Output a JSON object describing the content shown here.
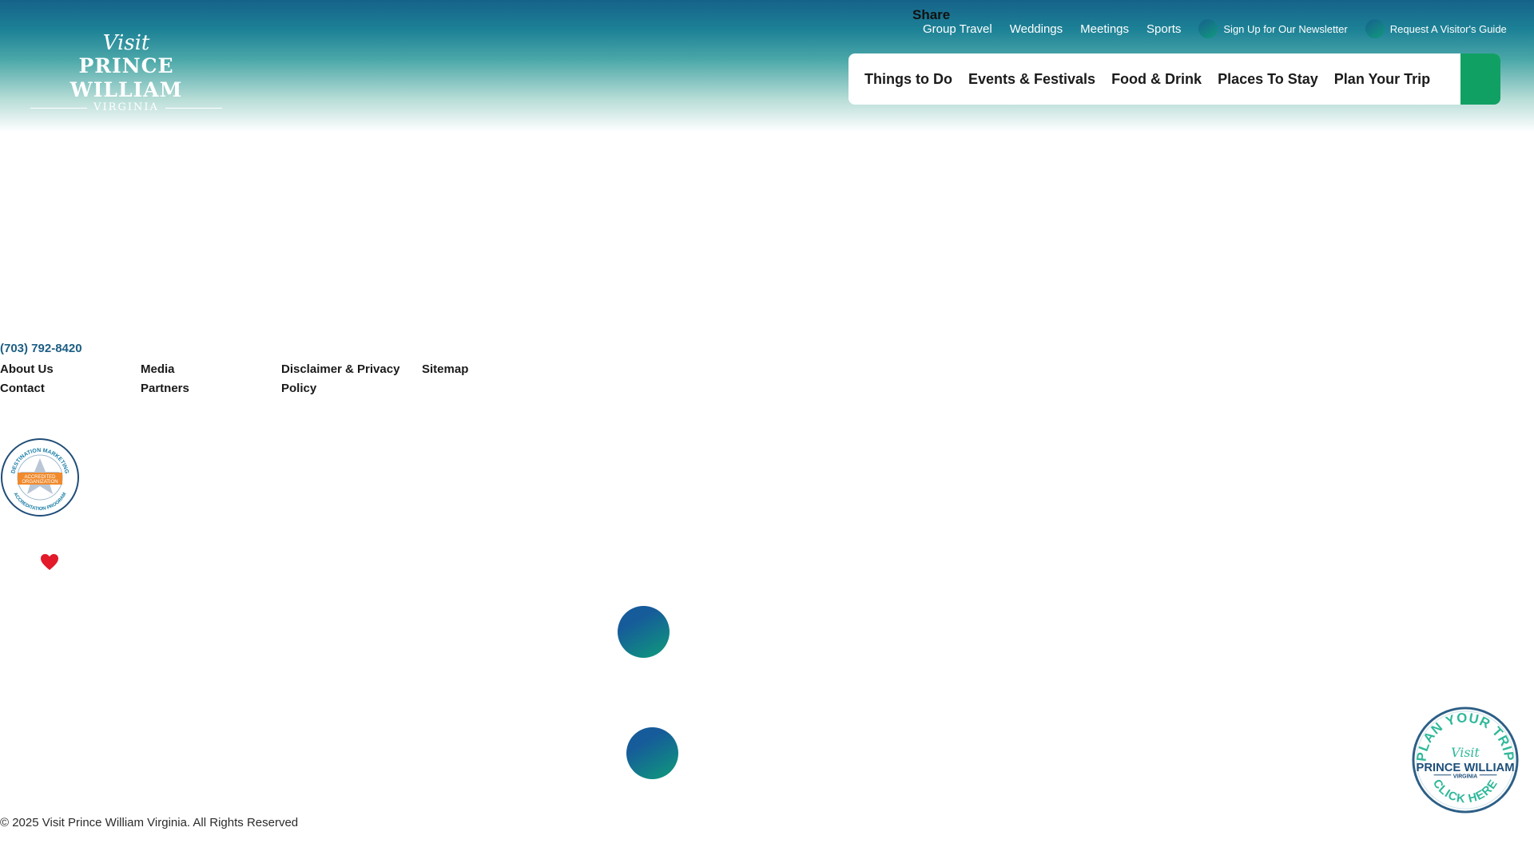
{
  "share": {
    "label": "Share"
  },
  "utility": {
    "links": [
      "Group Travel",
      "Weddings",
      "Meetings",
      "Sports"
    ],
    "newsletter": "Sign Up for  Our Newsletter",
    "guide": "Request A Visitor's Guide"
  },
  "logo": {
    "visit": "Visit",
    "name": "PRINCE WILLIAM",
    "sub": "VIRGINIA"
  },
  "nav": {
    "items": [
      "Things to Do",
      "Events & Festivals",
      "Food & Drink",
      "Places To Stay",
      "Plan Your Trip"
    ],
    "search_icon": "search-icon"
  },
  "footer": {
    "phone": "(703) 792-8420",
    "col1": [
      "About Us",
      "Contact"
    ],
    "col2": [
      "Media",
      "Partners"
    ],
    "col3": [
      "Disclaimer & Privacy",
      "Policy"
    ],
    "col4": [
      "Sitemap"
    ],
    "badge": {
      "top": "DESTINATION MARKETING",
      "mid1": "ACCREDITED",
      "mid2": "ORGANIZATION",
      "bottom": "ACCREDITATION PROGRAM"
    },
    "copyright": "© 2025 Visit Prince William Virginia. All Rights Reserved"
  },
  "plan_badge": {
    "top": "PLAN YOUR TRIP",
    "visit": "Visit",
    "name": "PRINCE WILLIAM",
    "sub": "VIRGINIA",
    "bottom": "CLICK HERE"
  },
  "colors": {
    "brand_blue": "#16628a",
    "brand_green": "#11a064",
    "phone_color": "#1d5e84",
    "heart": "#e21a2a"
  }
}
